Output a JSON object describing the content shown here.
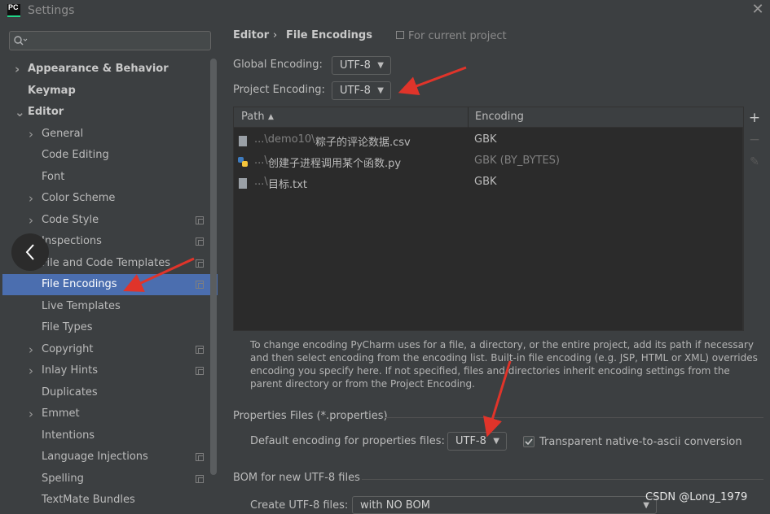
{
  "window": {
    "app_icon_text": "PC",
    "title": "Settings",
    "close_glyph": "✕"
  },
  "search": {
    "placeholder": ""
  },
  "sidebar": {
    "items": [
      {
        "label": "Appearance & Behavior",
        "bold": true,
        "chevron": "right"
      },
      {
        "label": "Keymap",
        "bold": true
      },
      {
        "label": "Editor",
        "bold": true,
        "chevron": "down"
      },
      {
        "label": "General",
        "chevron": "right"
      },
      {
        "label": "Code Editing"
      },
      {
        "label": "Font"
      },
      {
        "label": "Color Scheme",
        "chevron": "right"
      },
      {
        "label": "Code Style",
        "chevron": "right",
        "project_icon": true
      },
      {
        "label": "Inspections",
        "project_icon": true
      },
      {
        "label": "File and Code Templates",
        "project_icon": true
      },
      {
        "label": "File Encodings",
        "selected": true,
        "project_icon": true
      },
      {
        "label": "Live Templates"
      },
      {
        "label": "File Types"
      },
      {
        "label": "Copyright",
        "chevron": "right",
        "project_icon": true
      },
      {
        "label": "Inlay Hints",
        "chevron": "right",
        "project_icon": true
      },
      {
        "label": "Duplicates"
      },
      {
        "label": "Emmet",
        "chevron": "right"
      },
      {
        "label": "Intentions"
      },
      {
        "label": "Language Injections",
        "project_icon": true
      },
      {
        "label": "Spelling",
        "project_icon": true
      },
      {
        "label": "TextMate Bundles"
      }
    ]
  },
  "breadcrumb": {
    "parent": "Editor",
    "separator": "›",
    "current": "File Encodings",
    "scope": "For current project"
  },
  "encodings": {
    "global_label": "Global Encoding:",
    "global_value": "UTF-8",
    "project_label": "Project Encoding:",
    "project_value": "UTF-8"
  },
  "table": {
    "columns": [
      "Path",
      "Encoding"
    ],
    "sort_glyph": "▲",
    "rows": [
      {
        "path_prefix": "...\\demo10\\",
        "path_name": "粽子的评论数据.csv",
        "encoding": "GBK",
        "type": "file"
      },
      {
        "path_prefix": "...\\",
        "path_name": "创建子进程调用某个函数.py",
        "encoding": "GBK (BY_BYTES)",
        "type": "python",
        "dim": true
      },
      {
        "path_prefix": "...\\",
        "path_name": "目标.txt",
        "encoding": "GBK",
        "type": "file"
      }
    ],
    "tools": [
      "+",
      "−",
      "✎"
    ]
  },
  "help_text": "To change encoding PyCharm uses for a file, a directory, or the entire project, add its path if necessary and then select encoding from the encoding list. Built-in file encoding (e.g. JSP, HTML or XML) overrides encoding you specify here. If not specified, files and directories inherit encoding settings from the parent directory or from the Project Encoding.",
  "properties": {
    "section_title": "Properties Files (*.properties)",
    "default_label": "Default encoding for properties files:",
    "default_value": "UTF-8",
    "native_to_ascii_label": "Transparent native-to-ascii conversion",
    "native_to_ascii_checked": true
  },
  "bom": {
    "section_title": "BOM for new UTF-8 files",
    "create_label": "Create UTF-8 files:",
    "create_value": "with NO BOM"
  },
  "watermark": "CSDN @Long_1979",
  "colors": {
    "background": "#3c3f41",
    "table_bg": "#2b2b2b",
    "selection": "#4b6eaf",
    "annotation_arrow": "#e0342a"
  }
}
